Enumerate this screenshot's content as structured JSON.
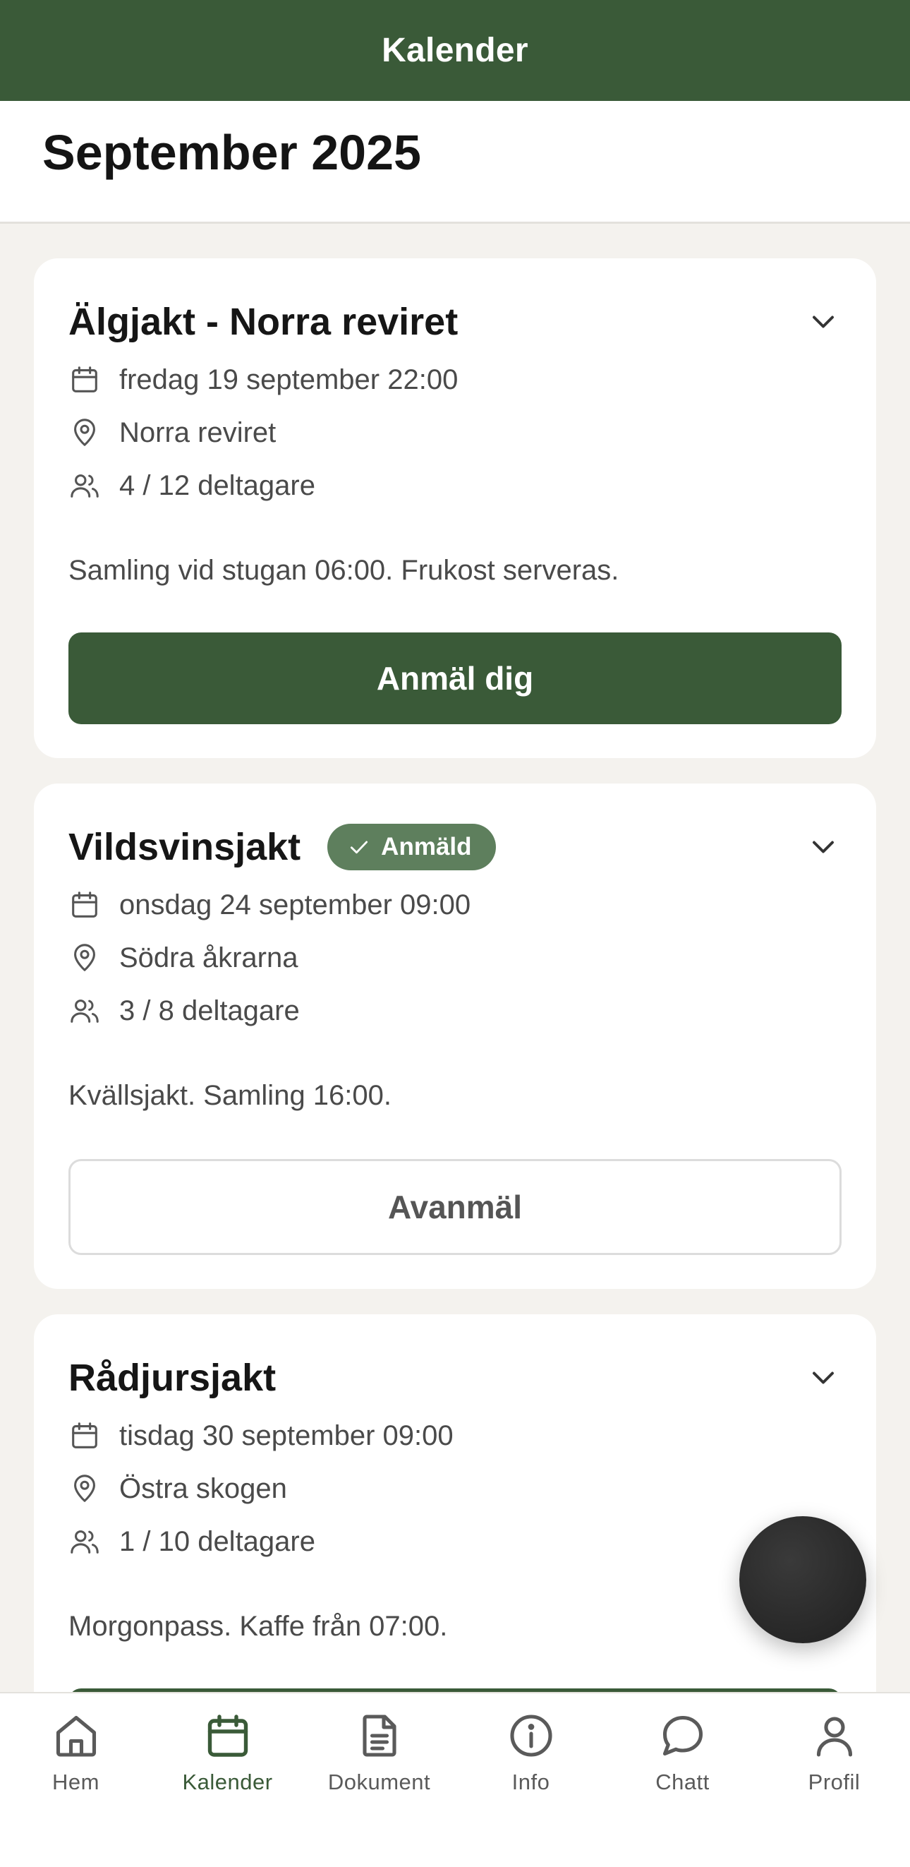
{
  "header": {
    "title": "Kalender"
  },
  "month": {
    "label": "September 2025"
  },
  "colors": {
    "brand": "#3a5a38",
    "badge": "#5e7f5d",
    "background": "#f4f2ee"
  },
  "events": [
    {
      "title": "Älgjakt - Norra reviret",
      "date": "fredag 19 september 22:00",
      "location": "Norra reviret",
      "participants": "4 / 12 deltagare",
      "description": "Samling vid stugan 06:00. Frukost serveras.",
      "action_label": "Anmäl dig"
    },
    {
      "title": "Vildsvinsjakt",
      "badge": "Anmäld",
      "date": "onsdag 24 september 09:00",
      "location": "Södra åkrarna",
      "participants": "3 / 8 deltagare",
      "description": "Kvällsjakt. Samling 16:00.",
      "action_label": "Avanmäl"
    },
    {
      "title": "Rådjursjakt",
      "date": "tisdag 30 september 09:00",
      "location": "Östra skogen",
      "participants": "1 / 10 deltagare",
      "description": "Morgonpass. Kaffe från 07:00.",
      "action_label": ""
    }
  ],
  "nav": {
    "items": [
      {
        "label": "Hem",
        "icon": "home-icon"
      },
      {
        "label": "Kalender",
        "icon": "calendar-icon",
        "active": true
      },
      {
        "label": "Dokument",
        "icon": "document-icon"
      },
      {
        "label": "Info",
        "icon": "info-icon"
      },
      {
        "label": "Chatt",
        "icon": "chat-icon"
      },
      {
        "label": "Profil",
        "icon": "profile-icon"
      }
    ]
  }
}
